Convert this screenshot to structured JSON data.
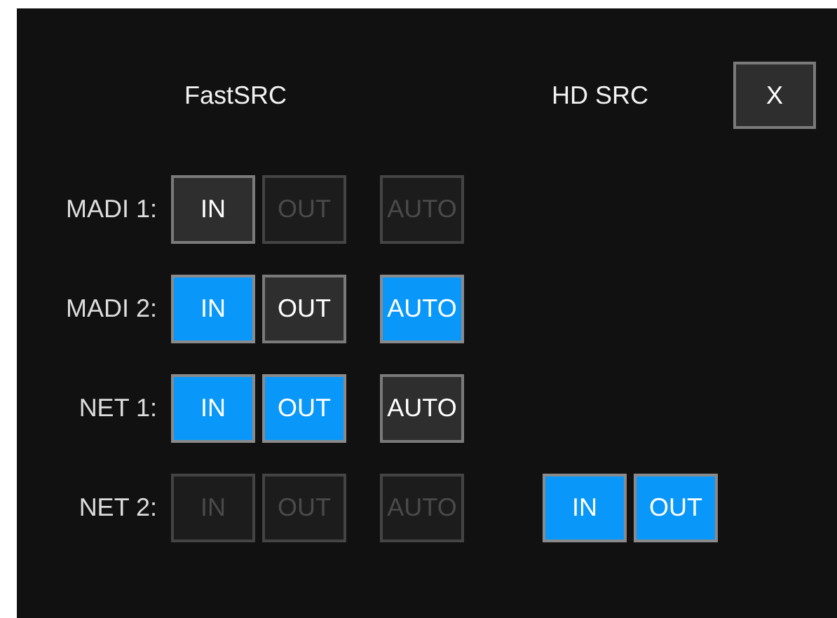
{
  "dialog": {
    "headers": [
      "FastSRC",
      "HD SRC"
    ],
    "close_button": "X",
    "rows": [
      {
        "label": "MADI 1:",
        "fast_src": [
          {
            "label": "IN",
            "selected": false,
            "disabled": false
          },
          {
            "label": "OUT",
            "selected": false,
            "disabled": true
          },
          {
            "label": "AUTO",
            "selected": false,
            "disabled": true
          }
        ]
      },
      {
        "label": "MADI 2:",
        "fast_src": [
          {
            "label": "IN",
            "selected": true,
            "disabled": false
          },
          {
            "label": "OUT",
            "selected": false,
            "disabled": false
          },
          {
            "label": "AUTO",
            "selected": true,
            "disabled": false
          }
        ]
      },
      {
        "label": "NET 1:",
        "fast_src": [
          {
            "label": "IN",
            "selected": true,
            "disabled": false
          },
          {
            "label": "OUT",
            "selected": true,
            "disabled": false
          },
          {
            "label": "AUTO",
            "selected": false,
            "disabled": false
          }
        ]
      },
      {
        "label": "NET 2:",
        "fast_src": [
          {
            "label": "IN",
            "selected": false,
            "disabled": true
          },
          {
            "label": "OUT",
            "selected": false,
            "disabled": true
          },
          {
            "label": "AUTO",
            "selected": false,
            "disabled": true
          }
        ],
        "hd_src": [
          {
            "label": "IN",
            "selected": true,
            "disabled": false
          },
          {
            "label": "OUT",
            "selected": true,
            "disabled": false
          }
        ]
      }
    ]
  }
}
